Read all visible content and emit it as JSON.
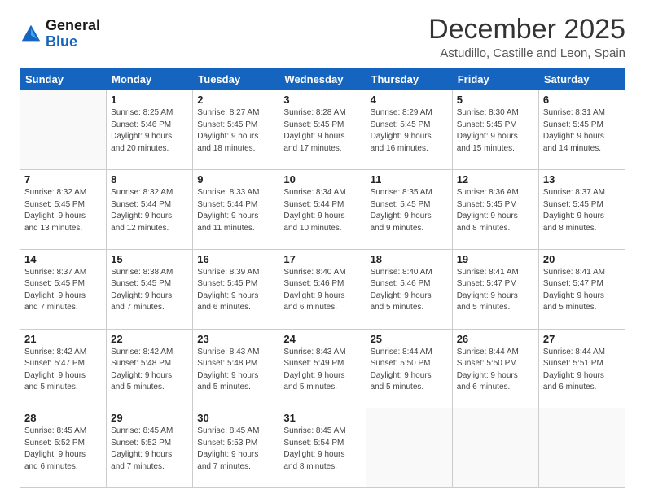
{
  "header": {
    "logo_line1": "General",
    "logo_line2": "Blue",
    "title": "December 2025",
    "subtitle": "Astudillo, Castille and Leon, Spain"
  },
  "weekdays": [
    "Sunday",
    "Monday",
    "Tuesday",
    "Wednesday",
    "Thursday",
    "Friday",
    "Saturday"
  ],
  "weeks": [
    [
      {
        "day": "",
        "info": ""
      },
      {
        "day": "1",
        "info": "Sunrise: 8:25 AM\nSunset: 5:46 PM\nDaylight: 9 hours\nand 20 minutes."
      },
      {
        "day": "2",
        "info": "Sunrise: 8:27 AM\nSunset: 5:45 PM\nDaylight: 9 hours\nand 18 minutes."
      },
      {
        "day": "3",
        "info": "Sunrise: 8:28 AM\nSunset: 5:45 PM\nDaylight: 9 hours\nand 17 minutes."
      },
      {
        "day": "4",
        "info": "Sunrise: 8:29 AM\nSunset: 5:45 PM\nDaylight: 9 hours\nand 16 minutes."
      },
      {
        "day": "5",
        "info": "Sunrise: 8:30 AM\nSunset: 5:45 PM\nDaylight: 9 hours\nand 15 minutes."
      },
      {
        "day": "6",
        "info": "Sunrise: 8:31 AM\nSunset: 5:45 PM\nDaylight: 9 hours\nand 14 minutes."
      }
    ],
    [
      {
        "day": "7",
        "info": "Sunrise: 8:32 AM\nSunset: 5:45 PM\nDaylight: 9 hours\nand 13 minutes."
      },
      {
        "day": "8",
        "info": "Sunrise: 8:32 AM\nSunset: 5:44 PM\nDaylight: 9 hours\nand 12 minutes."
      },
      {
        "day": "9",
        "info": "Sunrise: 8:33 AM\nSunset: 5:44 PM\nDaylight: 9 hours\nand 11 minutes."
      },
      {
        "day": "10",
        "info": "Sunrise: 8:34 AM\nSunset: 5:44 PM\nDaylight: 9 hours\nand 10 minutes."
      },
      {
        "day": "11",
        "info": "Sunrise: 8:35 AM\nSunset: 5:45 PM\nDaylight: 9 hours\nand 9 minutes."
      },
      {
        "day": "12",
        "info": "Sunrise: 8:36 AM\nSunset: 5:45 PM\nDaylight: 9 hours\nand 8 minutes."
      },
      {
        "day": "13",
        "info": "Sunrise: 8:37 AM\nSunset: 5:45 PM\nDaylight: 9 hours\nand 8 minutes."
      }
    ],
    [
      {
        "day": "14",
        "info": "Sunrise: 8:37 AM\nSunset: 5:45 PM\nDaylight: 9 hours\nand 7 minutes."
      },
      {
        "day": "15",
        "info": "Sunrise: 8:38 AM\nSunset: 5:45 PM\nDaylight: 9 hours\nand 7 minutes."
      },
      {
        "day": "16",
        "info": "Sunrise: 8:39 AM\nSunset: 5:45 PM\nDaylight: 9 hours\nand 6 minutes."
      },
      {
        "day": "17",
        "info": "Sunrise: 8:40 AM\nSunset: 5:46 PM\nDaylight: 9 hours\nand 6 minutes."
      },
      {
        "day": "18",
        "info": "Sunrise: 8:40 AM\nSunset: 5:46 PM\nDaylight: 9 hours\nand 5 minutes."
      },
      {
        "day": "19",
        "info": "Sunrise: 8:41 AM\nSunset: 5:47 PM\nDaylight: 9 hours\nand 5 minutes."
      },
      {
        "day": "20",
        "info": "Sunrise: 8:41 AM\nSunset: 5:47 PM\nDaylight: 9 hours\nand 5 minutes."
      }
    ],
    [
      {
        "day": "21",
        "info": "Sunrise: 8:42 AM\nSunset: 5:47 PM\nDaylight: 9 hours\nand 5 minutes."
      },
      {
        "day": "22",
        "info": "Sunrise: 8:42 AM\nSunset: 5:48 PM\nDaylight: 9 hours\nand 5 minutes."
      },
      {
        "day": "23",
        "info": "Sunrise: 8:43 AM\nSunset: 5:48 PM\nDaylight: 9 hours\nand 5 minutes."
      },
      {
        "day": "24",
        "info": "Sunrise: 8:43 AM\nSunset: 5:49 PM\nDaylight: 9 hours\nand 5 minutes."
      },
      {
        "day": "25",
        "info": "Sunrise: 8:44 AM\nSunset: 5:50 PM\nDaylight: 9 hours\nand 5 minutes."
      },
      {
        "day": "26",
        "info": "Sunrise: 8:44 AM\nSunset: 5:50 PM\nDaylight: 9 hours\nand 6 minutes."
      },
      {
        "day": "27",
        "info": "Sunrise: 8:44 AM\nSunset: 5:51 PM\nDaylight: 9 hours\nand 6 minutes."
      }
    ],
    [
      {
        "day": "28",
        "info": "Sunrise: 8:45 AM\nSunset: 5:52 PM\nDaylight: 9 hours\nand 6 minutes."
      },
      {
        "day": "29",
        "info": "Sunrise: 8:45 AM\nSunset: 5:52 PM\nDaylight: 9 hours\nand 7 minutes."
      },
      {
        "day": "30",
        "info": "Sunrise: 8:45 AM\nSunset: 5:53 PM\nDaylight: 9 hours\nand 7 minutes."
      },
      {
        "day": "31",
        "info": "Sunrise: 8:45 AM\nSunset: 5:54 PM\nDaylight: 9 hours\nand 8 minutes."
      },
      {
        "day": "",
        "info": ""
      },
      {
        "day": "",
        "info": ""
      },
      {
        "day": "",
        "info": ""
      }
    ]
  ]
}
